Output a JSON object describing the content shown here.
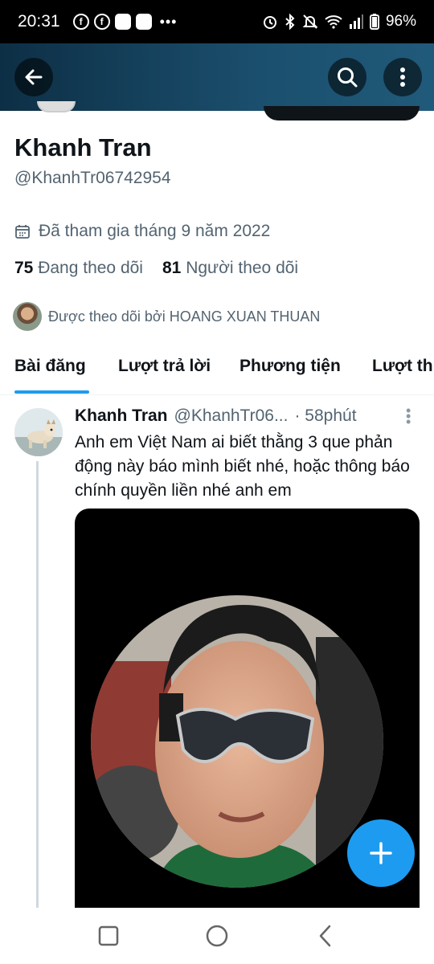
{
  "status_bar": {
    "time": "20:31",
    "overflow": "•••",
    "battery": "96%"
  },
  "header": {
    "back_icon": "arrow-left-icon",
    "search_icon": "search-icon",
    "more_icon": "more-vertical-icon"
  },
  "profile": {
    "name": "Khanh Tran",
    "handle": "@KhanhTr06742954",
    "joined": "Đã tham gia tháng 9 năm 2022",
    "following_count": "75",
    "following_label": "Đang theo dõi",
    "followers_count": "81",
    "followers_label": "Người theo dõi",
    "followed_by": "Được theo dõi bởi HOANG XUAN THUAN"
  },
  "tabs": [
    {
      "label": "Bài đăng",
      "active": true
    },
    {
      "label": "Lượt trả lời",
      "active": false
    },
    {
      "label": "Phương tiện",
      "active": false
    },
    {
      "label": "Lượt th",
      "active": false
    }
  ],
  "post": {
    "name": "Khanh Tran",
    "handle": "@KhanhTr06...",
    "time": "· 58phút",
    "text": "Anh em Việt Nam ai biết thằng 3 que phản động này báo mình biết nhé, hoặc thông báo chính quyền liền nhé anh em"
  },
  "fab_icon": "plus-icon",
  "colors": {
    "accent": "#1d9bf0",
    "header_bg": "#1b4f6e",
    "text_primary": "#0f1419",
    "text_secondary": "#536471"
  }
}
